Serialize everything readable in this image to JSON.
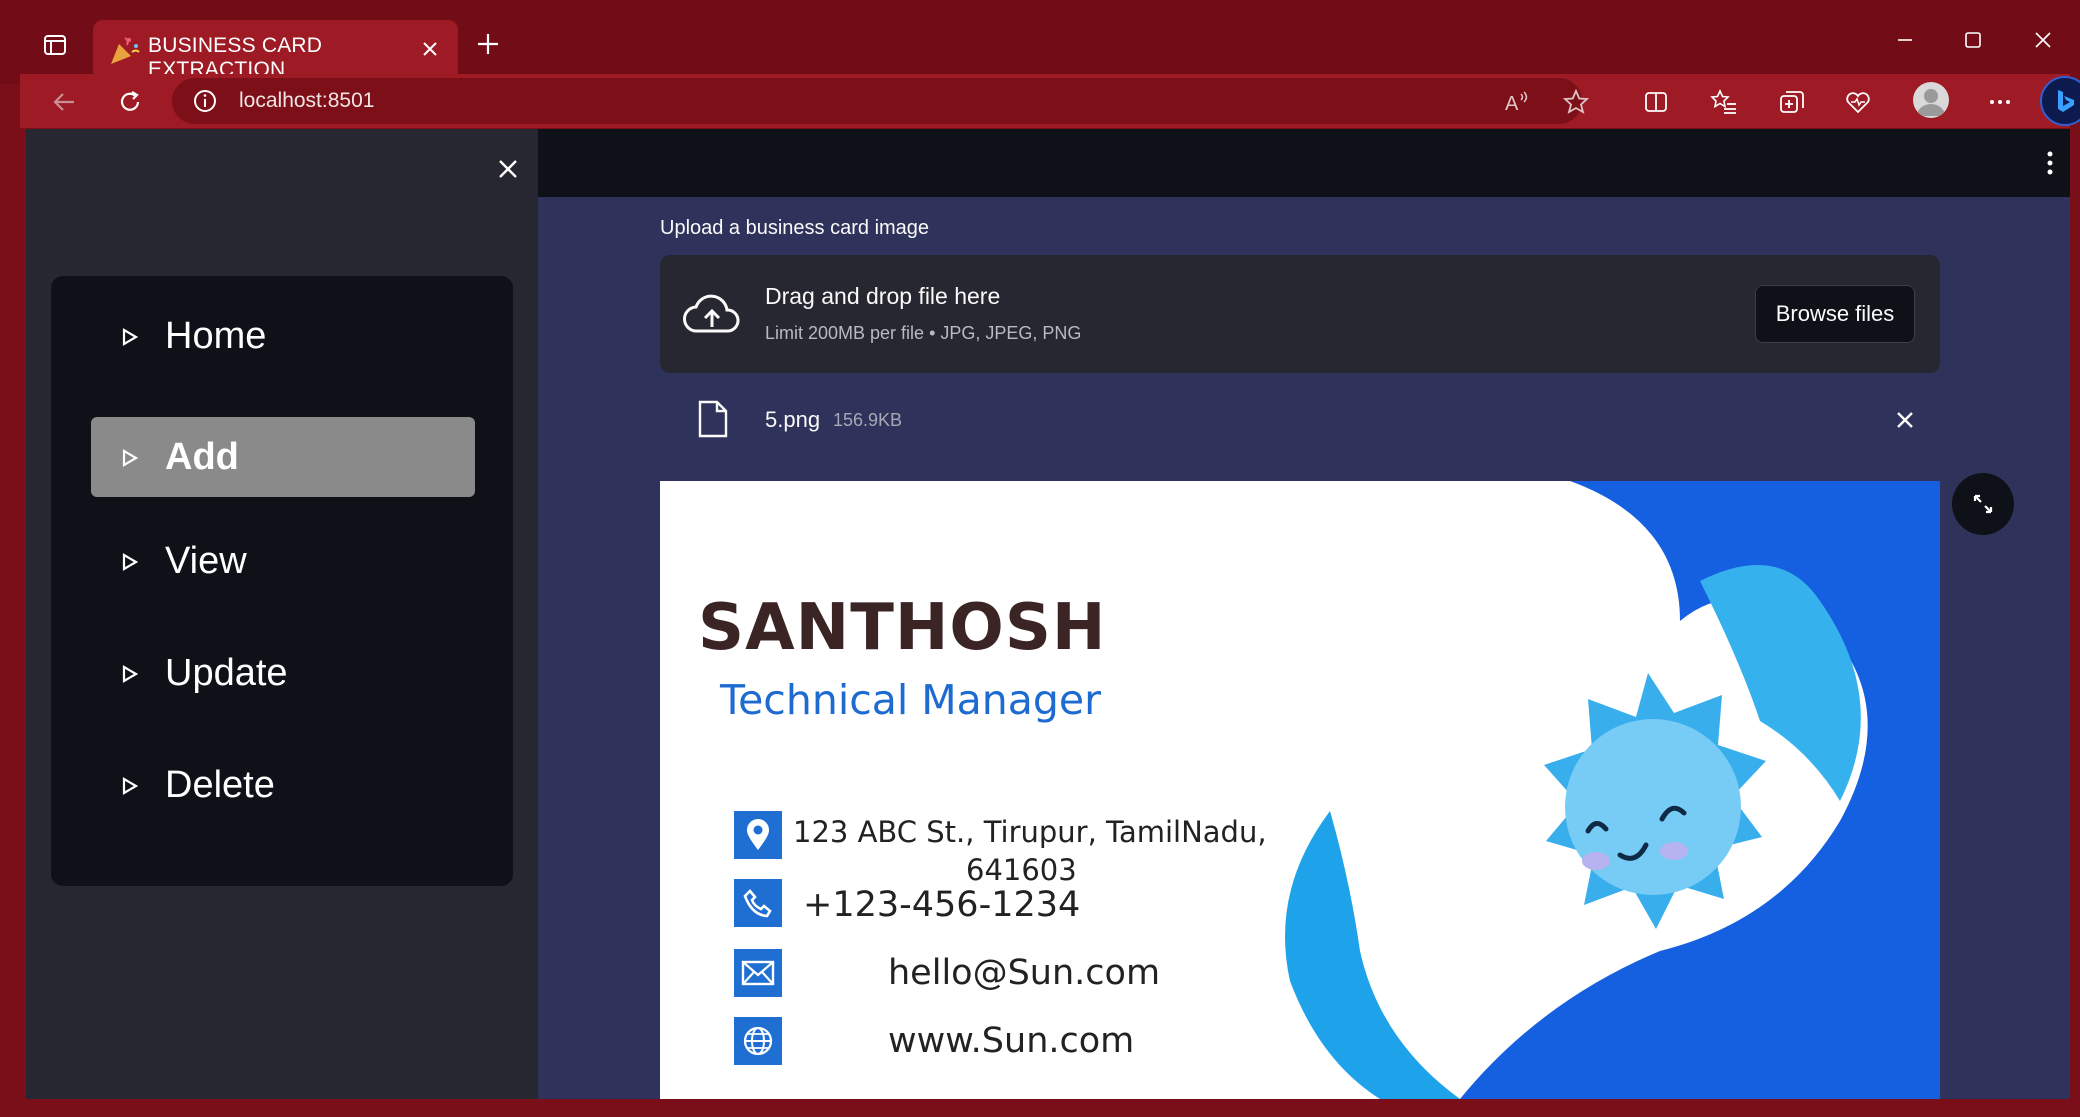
{
  "browser": {
    "tab_title": "BUSINESS CARD EXTRACTION",
    "url": "localhost:8501"
  },
  "sidebar": {
    "items": [
      {
        "label": "Home",
        "active": false
      },
      {
        "label": "Add",
        "active": true
      },
      {
        "label": "View",
        "active": false
      },
      {
        "label": "Update",
        "active": false
      },
      {
        "label": "Delete",
        "active": false
      }
    ]
  },
  "uploader": {
    "label": "Upload a business card image",
    "drag_text": "Drag and drop file here",
    "limit_text": "Limit 200MB per file • JPG, JPEG, PNG",
    "browse_label": "Browse files",
    "file_name": "5.png",
    "file_size": "156.9KB"
  },
  "card": {
    "name": "SANTHOSH",
    "title": "Technical Manager",
    "address_line1": "123 ABC St., Tirupur, TamilNadu,",
    "address_line2": "641603",
    "phone": "+123-456-1234",
    "email": "hello@Sun.com",
    "website": "www.Sun.com"
  },
  "colors": {
    "browser_frame": "#7a0f1a",
    "app_bg": "#2f325a",
    "sidebar_bg": "#262730",
    "menu_bg": "#0e1117",
    "active_item": "#8a8a8a",
    "card_blue": "#1f6fd3"
  }
}
